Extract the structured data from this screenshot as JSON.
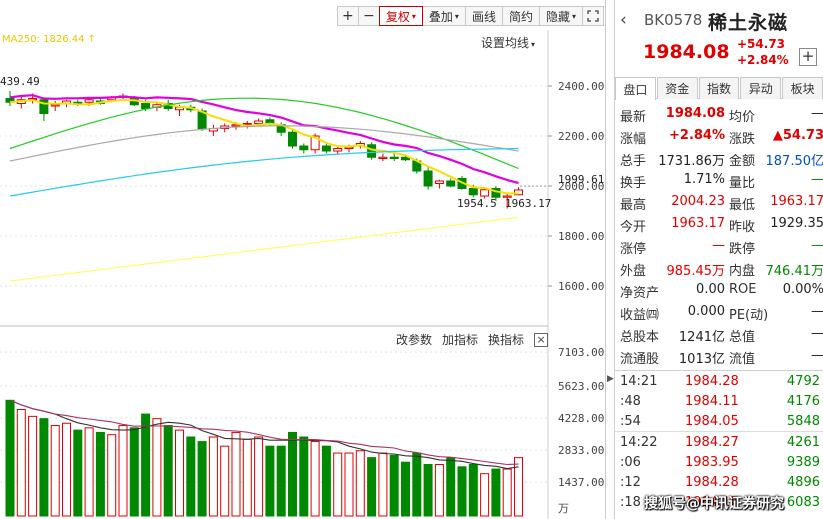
{
  "toolbar": {
    "zoom_in": "+",
    "zoom_out": "−",
    "adjust_label": "复权",
    "overlay_label": "叠加",
    "draw_label": "画线",
    "brief_label": "简约",
    "hide_label": "隐藏",
    "caret": "▾"
  },
  "chart": {
    "ma_legend": "MA250: 1826.44 ↑",
    "ma_setting_label": "设置均线",
    "axis_labels": [
      "2400.00",
      "2200.00",
      "2000.00",
      "1800.00",
      "1600.00"
    ],
    "last_price_tag": "1999.61",
    "high_annotation": "439.49",
    "low_annotation_left": "1954.5",
    "low_annotation_right": "1963.17"
  },
  "volume": {
    "change_params": "改参数",
    "add_indicator": "加指标",
    "swap_indicator": "换指标",
    "close_symbol": "×",
    "axis_labels": [
      "7103.00",
      "5623.00",
      "4228.00",
      "2833.00",
      "1437.00",
      "万"
    ]
  },
  "colors": {
    "up": "#e00000",
    "down": "#008800",
    "ma5": "#f5e000",
    "ma10": "#e000e0",
    "ma20": "#22cc22",
    "ma30": "#aaaaaa",
    "ma60": "#22ccee",
    "ma250": "#ffff66"
  },
  "chart_data": {
    "type": "candlestick",
    "ylim": [
      1500,
      2500
    ],
    "candles": [
      {
        "o": 2350,
        "h": 2380,
        "l": 2320,
        "c": 2335
      },
      {
        "o": 2330,
        "h": 2360,
        "l": 2310,
        "c": 2345
      },
      {
        "o": 2345,
        "h": 2370,
        "l": 2330,
        "c": 2350
      },
      {
        "o": 2345,
        "h": 2352,
        "l": 2260,
        "c": 2290
      },
      {
        "o": 2320,
        "h": 2340,
        "l": 2300,
        "c": 2325
      },
      {
        "o": 2330,
        "h": 2345,
        "l": 2315,
        "c": 2340
      },
      {
        "o": 2335,
        "h": 2345,
        "l": 2320,
        "c": 2330
      },
      {
        "o": 2335,
        "h": 2350,
        "l": 2320,
        "c": 2345
      },
      {
        "o": 2340,
        "h": 2350,
        "l": 2325,
        "c": 2330
      },
      {
        "o": 2345,
        "h": 2360,
        "l": 2335,
        "c": 2355
      },
      {
        "o": 2355,
        "h": 2370,
        "l": 2345,
        "c": 2360
      },
      {
        "o": 2350,
        "h": 2360,
        "l": 2320,
        "c": 2325
      },
      {
        "o": 2330,
        "h": 2345,
        "l": 2300,
        "c": 2310
      },
      {
        "o": 2315,
        "h": 2335,
        "l": 2300,
        "c": 2325
      },
      {
        "o": 2330,
        "h": 2345,
        "l": 2300,
        "c": 2310
      },
      {
        "o": 2305,
        "h": 2325,
        "l": 2280,
        "c": 2315
      },
      {
        "o": 2315,
        "h": 2325,
        "l": 2295,
        "c": 2305
      },
      {
        "o": 2300,
        "h": 2310,
        "l": 2220,
        "c": 2230
      },
      {
        "o": 2220,
        "h": 2245,
        "l": 2200,
        "c": 2230
      },
      {
        "o": 2230,
        "h": 2250,
        "l": 2215,
        "c": 2240
      },
      {
        "o": 2240,
        "h": 2255,
        "l": 2225,
        "c": 2245
      },
      {
        "o": 2245,
        "h": 2260,
        "l": 2230,
        "c": 2250
      },
      {
        "o": 2250,
        "h": 2270,
        "l": 2240,
        "c": 2260
      },
      {
        "o": 2265,
        "h": 2275,
        "l": 2240,
        "c": 2250
      },
      {
        "o": 2245,
        "h": 2255,
        "l": 2200,
        "c": 2215
      },
      {
        "o": 2215,
        "h": 2225,
        "l": 2150,
        "c": 2160
      },
      {
        "o": 2160,
        "h": 2170,
        "l": 2130,
        "c": 2145
      },
      {
        "o": 2145,
        "h": 2210,
        "l": 2130,
        "c": 2200
      },
      {
        "o": 2160,
        "h": 2170,
        "l": 2130,
        "c": 2140
      },
      {
        "o": 2140,
        "h": 2160,
        "l": 2125,
        "c": 2150
      },
      {
        "o": 2150,
        "h": 2165,
        "l": 2135,
        "c": 2155
      },
      {
        "o": 2160,
        "h": 2180,
        "l": 2150,
        "c": 2170
      },
      {
        "o": 2165,
        "h": 2175,
        "l": 2105,
        "c": 2115
      },
      {
        "o": 2110,
        "h": 2130,
        "l": 2100,
        "c": 2115
      },
      {
        "o": 2115,
        "h": 2135,
        "l": 2100,
        "c": 2110
      },
      {
        "o": 2115,
        "h": 2125,
        "l": 2100,
        "c": 2105
      },
      {
        "o": 2100,
        "h": 2110,
        "l": 2050,
        "c": 2060
      },
      {
        "o": 2060,
        "h": 2075,
        "l": 1985,
        "c": 2000
      },
      {
        "o": 2010,
        "h": 2025,
        "l": 1990,
        "c": 2020
      },
      {
        "o": 2020,
        "h": 2030,
        "l": 1995,
        "c": 2000
      },
      {
        "o": 2030,
        "h": 2040,
        "l": 1985,
        "c": 1990
      },
      {
        "o": 1990,
        "h": 2005,
        "l": 1954.5,
        "c": 1965
      },
      {
        "o": 1960,
        "h": 1995,
        "l": 1950,
        "c": 1985
      },
      {
        "o": 1990,
        "h": 2000,
        "l": 1940,
        "c": 1955
      },
      {
        "o": 1955,
        "h": 1970,
        "l": 1910,
        "c": 1960
      },
      {
        "o": 1965,
        "h": 1995,
        "l": 1963.17,
        "c": 1984
      }
    ],
    "volume": [
      5000,
      4600,
      4300,
      4200,
      3900,
      4000,
      3700,
      3800,
      3600,
      3500,
      3900,
      3800,
      4400,
      4200,
      3900,
      3700,
      3400,
      3200,
      3400,
      3000,
      3600,
      3300,
      3400,
      3000,
      3000,
      3600,
      3400,
      3200,
      3000,
      2700,
      2700,
      2800,
      2500,
      2700,
      2600,
      2300,
      2700,
      2200,
      2200,
      2500,
      2100,
      2200,
      1800,
      2000,
      2000,
      2500
    ]
  },
  "quote": {
    "back_icon": "‹",
    "code": "BK0578",
    "name": "稀土永磁",
    "price": "1984.08",
    "change": "+54.73",
    "change_pct": "+2.84%",
    "add_symbol": "+",
    "tabs": [
      "盘口",
      "资金",
      "指数",
      "异动",
      "板块"
    ],
    "rows": [
      {
        "l1": "最新",
        "v1": "1984.08",
        "l2": "均价",
        "v2": "—"
      },
      {
        "l1": "涨幅",
        "v1": "+2.84%",
        "l2": "涨跌",
        "v2": "▲54.73"
      },
      {
        "l1": "总手",
        "v1": "1731.86万",
        "l2": "金额",
        "v2": "187.50亿"
      },
      {
        "l1": "换手",
        "v1": "1.71%",
        "l2": "量比",
        "v2": "—"
      },
      {
        "l1": "最高",
        "v1": "2004.23",
        "l2": "最低",
        "v2": "1963.17"
      },
      {
        "l1": "今开",
        "v1": "1963.17",
        "l2": "昨收",
        "v2": "1929.35"
      },
      {
        "l1": "涨停",
        "v1": "—",
        "l2": "跌停",
        "v2": "—"
      },
      {
        "l1": "外盘",
        "v1": "985.45万",
        "l2": "内盘",
        "v2": "746.41万"
      },
      {
        "l1": "净资产",
        "v1": "0.00",
        "l2": "ROE",
        "v2": "0.00%"
      },
      {
        "l1": "收益㈣",
        "v1": "0.000",
        "l2": "PE(动)",
        "v2": "—"
      },
      {
        "l1": "总股本",
        "v1": "1241亿",
        "l2": "总值",
        "v2": "—"
      },
      {
        "l1": "流通股",
        "v1": "1013亿",
        "l2": "流值",
        "v2": "—"
      }
    ]
  },
  "ticks": [
    {
      "time": "14:21",
      "price": "1984.28",
      "qty": "4792"
    },
    {
      "time": ":48",
      "price": "1984.11",
      "qty": "4176"
    },
    {
      "time": ":54",
      "price": "1984.05",
      "qty": "5848"
    },
    {
      "time": "14:22",
      "price": "1984.27",
      "qty": "4261"
    },
    {
      "time": ":06",
      "price": "1983.95",
      "qty": "9389"
    },
    {
      "time": ":12",
      "price": "1984.28",
      "qty": "4896"
    },
    {
      "time": ":18",
      "price": "1984.15",
      "qty": "6083"
    }
  ],
  "watermark": "搜狐号@中讯证券研究"
}
